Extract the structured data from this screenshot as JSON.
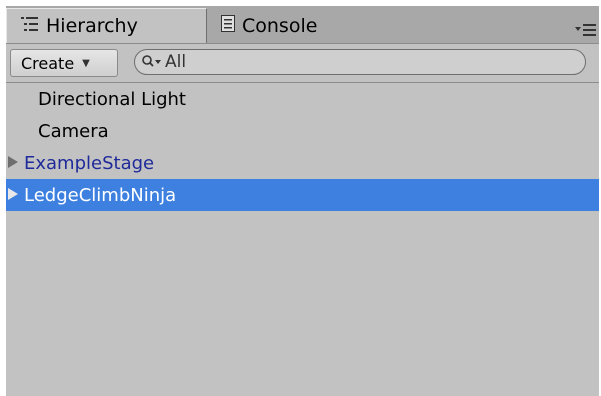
{
  "tabs": [
    {
      "label": "Hierarchy",
      "icon": "hierarchy-list-icon",
      "active": true
    },
    {
      "label": "Console",
      "icon": "console-doc-icon",
      "active": false
    }
  ],
  "toolbar": {
    "create_label": "Create",
    "create_caret": "▼",
    "search_placeholder": "All",
    "search_value": ""
  },
  "hierarchy": {
    "items": [
      {
        "label": "Directional Light",
        "has_children": false,
        "prefab": false,
        "selected": false
      },
      {
        "label": "Camera",
        "has_children": false,
        "prefab": false,
        "selected": false
      },
      {
        "label": "ExampleStage",
        "has_children": true,
        "prefab": true,
        "selected": false
      },
      {
        "label": "LedgeClimbNinja",
        "has_children": true,
        "prefab": true,
        "selected": true
      }
    ]
  },
  "colors": {
    "panel_bg": "#c2c2c2",
    "tabstrip_bg": "#a8a8a8",
    "selection": "#3d80e0",
    "prefab_text": "#1f2a9a"
  }
}
